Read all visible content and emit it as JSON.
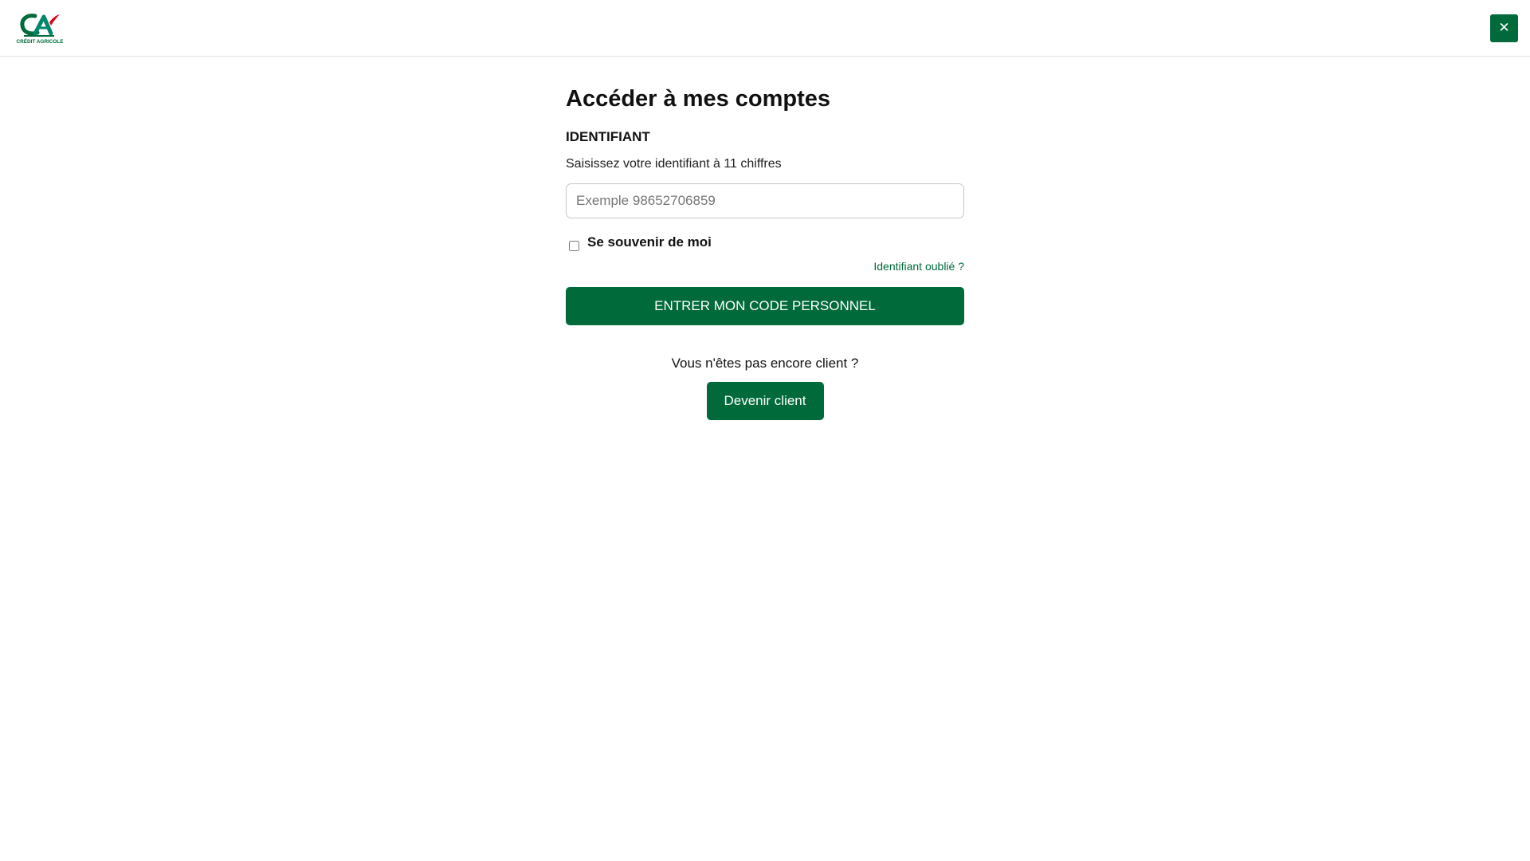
{
  "brand": {
    "name": "CRÉDIT AGRICOLE",
    "accent_color": "#006a3a",
    "logo_red": "#e2001a"
  },
  "header": {
    "logo_text": "CRÉDIT AGRICOLE",
    "logo_icon": "credit-agricole-logo",
    "close_label": "✕",
    "close_icon": "close-icon"
  },
  "login": {
    "title": "Accéder à mes comptes",
    "id_label": "IDENTIFIANT",
    "id_help": "Saisissez votre identifiant à 11 chiffres",
    "id_value": "",
    "id_placeholder": "Exemple 98652706859",
    "remember_label": "Se souvenir de moi",
    "remember_checked": false,
    "forgot_link": "Identifiant oublié ?",
    "submit_label": "ENTRER MON CODE PERSONNEL"
  },
  "signup": {
    "prompt": "Vous n'êtes pas encore client ?",
    "button_label": "Devenir client"
  }
}
